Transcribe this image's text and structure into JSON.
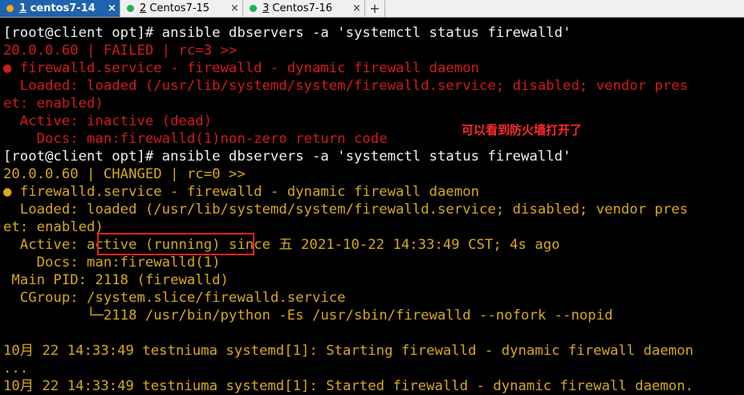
{
  "tabs": [
    {
      "num": "1",
      "label": "centos7-14",
      "color": "#f5a623",
      "active": true
    },
    {
      "num": "2",
      "label": "Centos7-15",
      "color": "#22b14c",
      "active": false
    },
    {
      "num": "3",
      "label": "Centos7-16",
      "color": "#22b14c",
      "active": false
    }
  ],
  "tab_close_glyph": "×",
  "add_tab_glyph": "+",
  "terminal": {
    "lines": [
      {
        "text": "[root@client opt]# ansible dbservers -a 'systemctl status firewalld'",
        "color": "white"
      },
      {
        "text": "20.0.0.60 | FAILED | rc=3 >>",
        "color": "red"
      },
      {
        "text": "● firewalld.service - firewalld - dynamic firewall daemon",
        "color": "red"
      },
      {
        "text": "  Loaded: loaded (/usr/lib/systemd/system/firewalld.service; disabled; vendor pres",
        "color": "red"
      },
      {
        "text": "et: enabled)",
        "color": "red"
      },
      {
        "text": "  Active: inactive (dead)",
        "color": "red"
      },
      {
        "text": "    Docs: man:firewalld(1)non-zero return code",
        "color": "red"
      },
      {
        "text": "[root@client opt]# ansible dbservers -a 'systemctl status firewalld'",
        "color": "white"
      },
      {
        "text": "20.0.0.60 | CHANGED | rc=0 >>",
        "color": "yellow"
      },
      {
        "text": "● firewalld.service - firewalld - dynamic firewall daemon",
        "color": "yellow"
      },
      {
        "text": "  Loaded: loaded (/usr/lib/systemd/system/firewalld.service; disabled; vendor pres",
        "color": "yellow"
      },
      {
        "text": "et: enabled)",
        "color": "yellow"
      },
      {
        "text": "  Active: active (running) since 五 2021-10-22 14:33:49 CST; 4s ago",
        "color": "yellow"
      },
      {
        "text": "    Docs: man:firewalld(1)",
        "color": "yellow"
      },
      {
        "text": " Main PID: 2118 (firewalld)",
        "color": "yellow"
      },
      {
        "text": "  CGroup: /system.slice/firewalld.service",
        "color": "yellow"
      },
      {
        "text": "          └─2118 /usr/bin/python -Es /usr/sbin/firewalld --nofork --nopid",
        "color": "yellow"
      },
      {
        "text": "",
        "color": "yellow"
      },
      {
        "text": "10月 22 14:33:49 testniuma systemd[1]: Starting firewalld - dynamic firewall daemon",
        "color": "yellow"
      },
      {
        "text": "...",
        "color": "yellow"
      },
      {
        "text": "10月 22 14:33:49 testniuma systemd[1]: Started firewalld - dynamic firewall daemon.",
        "color": "yellow"
      }
    ]
  },
  "annotation": {
    "text": "可以看到防火墙打开了"
  }
}
